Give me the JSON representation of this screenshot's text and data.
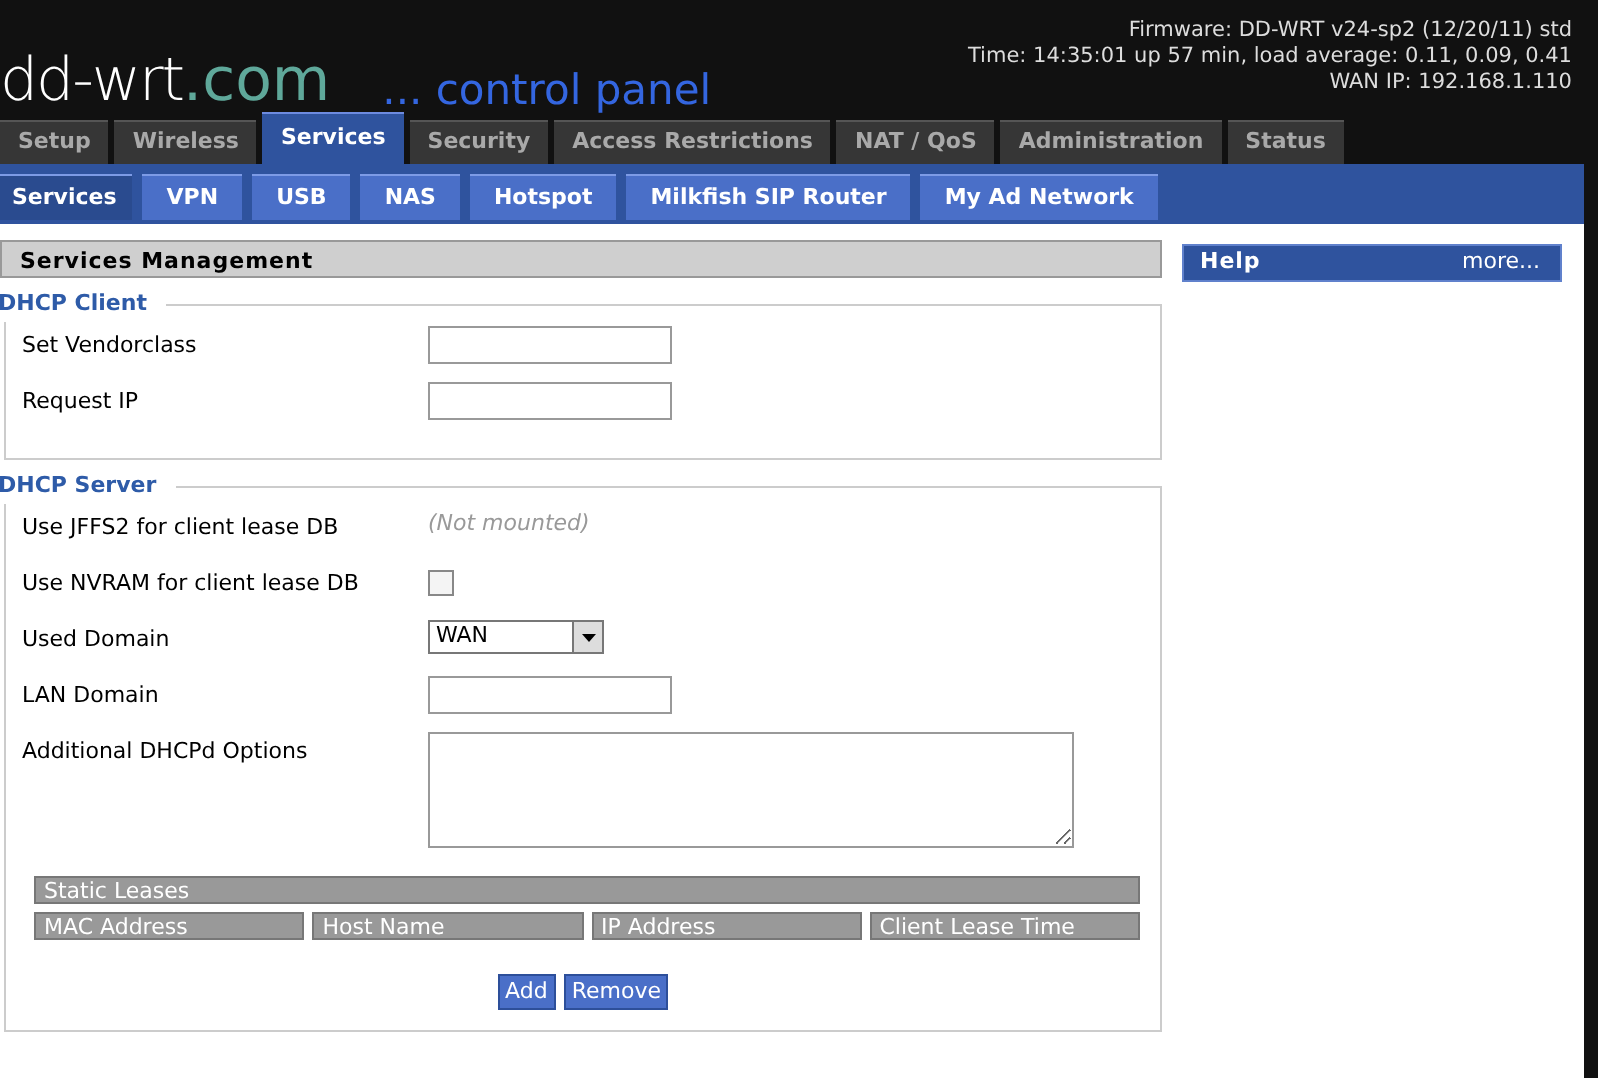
{
  "header": {
    "logo_main": "dd-wrt",
    "logo_domain": ".com",
    "tagline": "... control panel",
    "info": [
      "Firmware: DD-WRT v24-sp2 (12/20/11) std",
      "Time: 14:35:01 up 57 min, load average: 0.11, 0.09, 0.41",
      "WAN IP: 192.168.1.110"
    ]
  },
  "main_tabs": [
    {
      "label": "Setup",
      "selected": false
    },
    {
      "label": "Wireless",
      "selected": false
    },
    {
      "label": "Services",
      "selected": true
    },
    {
      "label": "Security",
      "selected": false
    },
    {
      "label": "Access Restrictions",
      "selected": false
    },
    {
      "label": "NAT / QoS",
      "selected": false
    },
    {
      "label": "Administration",
      "selected": false
    },
    {
      "label": "Status",
      "selected": false
    }
  ],
  "sub_tabs": [
    {
      "label": "Services",
      "selected": true
    },
    {
      "label": "VPN",
      "selected": false
    },
    {
      "label": "USB",
      "selected": false
    },
    {
      "label": "NAS",
      "selected": false
    },
    {
      "label": "Hotspot",
      "selected": false
    },
    {
      "label": "Milkfish SIP Router",
      "selected": false
    },
    {
      "label": "My Ad Network",
      "selected": false
    }
  ],
  "section_title": "Services Management",
  "help": {
    "title": "Help",
    "link": "more..."
  },
  "fieldsets": [
    {
      "legend": "DHCP Client",
      "fields": [
        {
          "label": "Set Vendorclass",
          "kind": "text"
        },
        {
          "label": "Request IP",
          "kind": "text"
        }
      ]
    },
    {
      "legend": "DHCP Server",
      "fields": [
        {
          "label": "Use JFFS2 for client lease DB",
          "kind": "note",
          "note": "(Not mounted)"
        },
        {
          "label": "Use NVRAM for client lease DB",
          "kind": "checkbox",
          "checked": false
        },
        {
          "label": "Used Domain",
          "kind": "select",
          "value": "WAN"
        },
        {
          "label": "LAN Domain",
          "kind": "text"
        },
        {
          "label": "Additional DHCPd Options",
          "kind": "textarea"
        }
      ],
      "static_leases": {
        "title": "Static Leases",
        "columns": [
          "MAC Address",
          "Host Name",
          "IP Address",
          "Client Lease Time"
        ]
      },
      "buttons": [
        "Add",
        "Remove"
      ]
    }
  ]
}
